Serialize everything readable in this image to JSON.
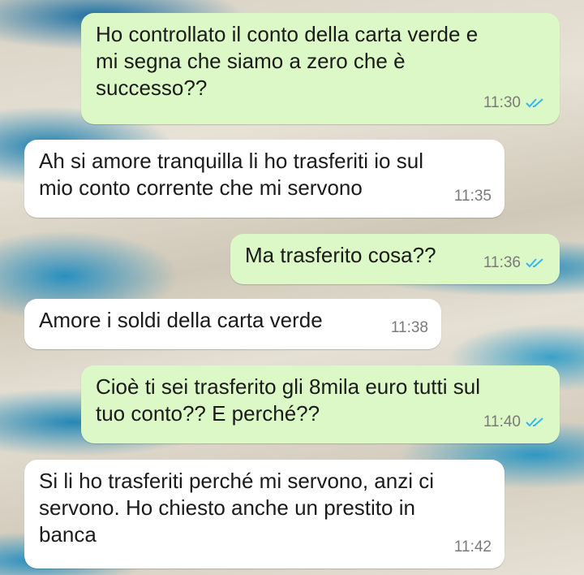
{
  "messages": [
    {
      "direction": "outgoing",
      "text": "Ho controllato il conto della carta verde e\nmi segna che siamo a zero che è\nsuccesso??",
      "time": "11:30",
      "status_icon": "double-check-read-icon"
    },
    {
      "direction": "incoming",
      "text": "Ah si amore tranquilla li ho trasferiti io sul\nmio conto corrente che mi servono",
      "time": "11:35"
    },
    {
      "direction": "outgoing",
      "text": "Ma trasferito cosa??",
      "time": "11:36",
      "status_icon": "double-check-read-icon"
    },
    {
      "direction": "incoming",
      "text": "Amore i soldi della carta verde",
      "time": "11:38"
    },
    {
      "direction": "outgoing",
      "text": "Cioè ti sei trasferito gli 8mila euro tutti sul\ntuo conto?? E perché??",
      "time": "11:40",
      "status_icon": "double-check-read-icon"
    },
    {
      "direction": "incoming",
      "text": "Si li ho trasferiti perché mi servono, anzi ci\nservono. Ho chiesto anche un prestito in\nbanca",
      "time": "11:42"
    }
  ],
  "colors": {
    "outgoing_bubble": "#dcf8c6",
    "incoming_bubble": "#ffffff",
    "read_ticks": "#34b7f1",
    "timestamp": "#7a7a7a"
  }
}
